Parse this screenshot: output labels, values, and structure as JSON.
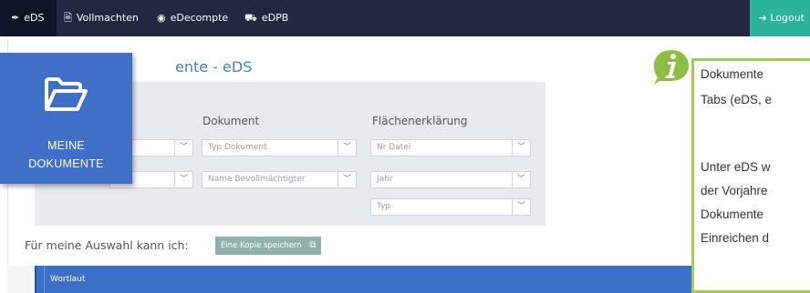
{
  "nav": {
    "items": [
      {
        "icon": "leaf-icon",
        "label": "eDS"
      },
      {
        "icon": "document-icon",
        "label": "Vollmachten"
      },
      {
        "icon": "coins-icon",
        "label": "eDecompte"
      },
      {
        "icon": "tractor-icon",
        "label": "eDPB"
      }
    ],
    "logout": "Logout"
  },
  "page": {
    "title_fragment": "ente - eDS"
  },
  "tile": {
    "line1": "MEINE",
    "line2": "DOKUMENTE",
    "icon": "folder-open-icon"
  },
  "filters": {
    "col_dokument": "Dokument",
    "col_flaechen": "Flächenerklärung",
    "typ_dokument": "Typ Dokument",
    "name_bevollmaechtigter": "Name Bevollmächtigter",
    "nr_datei": "Nr Datei",
    "jahr": "Jahr",
    "typ": "Typ"
  },
  "actions": {
    "label": "Für meine Auswahl kann ich:",
    "copy_button": "Eine Kopie speichern"
  },
  "table": {
    "header": "Wortlaut"
  },
  "info": {
    "lines": [
      "Dokumente",
      "Tabs (eDS, e",
      "",
      "Unter eDS w",
      "der Vorjahre",
      "Dokumente",
      "Einreichen d"
    ]
  },
  "colors": {
    "topbar": "#232840",
    "logout": "#2bb39c",
    "tile": "#3f6fc6",
    "info_border": "#a7c957",
    "table_header": "#3a70c8"
  }
}
